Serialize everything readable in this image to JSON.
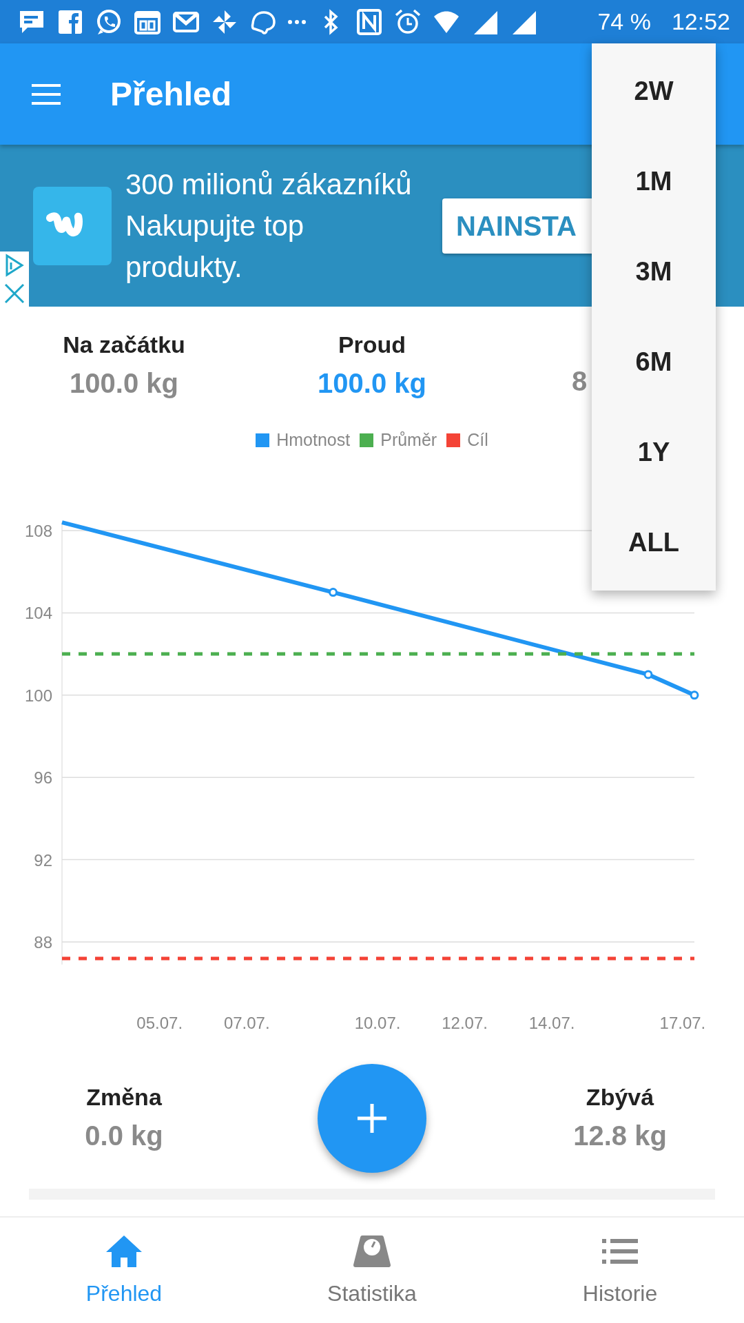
{
  "status_bar": {
    "battery": "74 %",
    "time": "12:52"
  },
  "app_bar": {
    "title": "Přehled"
  },
  "ad": {
    "text": "300 milionů zákazníků Nakupujte top produkty.",
    "button": "NAINSTA"
  },
  "summary": [
    {
      "label": "Na začátku",
      "value": "100.0 kg",
      "highlight": false
    },
    {
      "label": "Proud",
      "value": "100.0 kg",
      "highlight": true
    },
    {
      "value": "8",
      "highlight": false
    }
  ],
  "chart": {
    "chart_data": {
      "type": "line",
      "x": [
        2.83,
        9.05,
        16.28,
        17.34
      ],
      "xlim": [
        2.83,
        17.34
      ],
      "ylim": [
        86.9,
        108.4
      ],
      "grid": true,
      "yticks": [
        88,
        92,
        96,
        100,
        104,
        108
      ],
      "xticks": [
        {
          "value": 5.07,
          "label": "05.07."
        },
        {
          "value": 7.07,
          "label": "07.07."
        },
        {
          "value": 10.07,
          "label": "10.07."
        },
        {
          "value": 12.07,
          "label": "12.07."
        },
        {
          "value": 14.07,
          "label": "14.07."
        },
        {
          "value": 17.07,
          "label": "17.07."
        }
      ],
      "series": [
        {
          "name": "Hmotnost",
          "color": "#2196f3",
          "line_style": "solid",
          "values": [
            108.4,
            105,
            101,
            100
          ]
        },
        {
          "name": "Průměr",
          "color": "#4caf50",
          "line_style": "dashed",
          "values": [
            102,
            102,
            102,
            102
          ]
        },
        {
          "name": "Cíl",
          "color": "#f44336",
          "line_style": "dashed",
          "values": [
            87.2,
            87.2,
            87.2,
            87.2
          ]
        }
      ]
    }
  },
  "totals": [
    {
      "label": "Změna",
      "value": "0.0 kg"
    },
    {
      "label": "Zbývá",
      "value": "12.8 kg"
    }
  ],
  "bottom_nav": [
    {
      "label": "Přehled",
      "selected": true
    },
    {
      "label": "Statistika",
      "selected": false
    },
    {
      "label": "Historie",
      "selected": false
    }
  ],
  "period_menu": [
    "2W",
    "1M",
    "3M",
    "6M",
    "1Y",
    "ALL"
  ]
}
